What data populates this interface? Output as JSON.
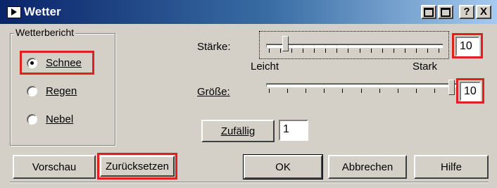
{
  "window": {
    "title": "Wetter",
    "title_icon": "play-icon",
    "buttons": [
      "restore",
      "maximize",
      "?",
      "X"
    ]
  },
  "group": {
    "label": "Wetterbericht",
    "options": [
      {
        "label": "Schnee",
        "checked": true
      },
      {
        "label": "Regen",
        "checked": false
      },
      {
        "label": "Nebel",
        "checked": false
      }
    ]
  },
  "staerke": {
    "label": "Stärke:",
    "left_label": "Leicht",
    "right_label": "Stark",
    "value": "10",
    "level": 0.08
  },
  "groesse": {
    "label": "Größe:",
    "value": "10",
    "level": 1.0
  },
  "zufaellig": {
    "button_label": "Zufällig",
    "value": "1"
  },
  "footer": {
    "preview": "Vorschau",
    "reset": "Zurücksetzen",
    "ok": "OK",
    "cancel": "Abbrechen",
    "help": "Hilfe"
  },
  "colors": {
    "highlight": "#e02020",
    "title_bar": "#0a246a",
    "face": "#d4d0c8"
  }
}
